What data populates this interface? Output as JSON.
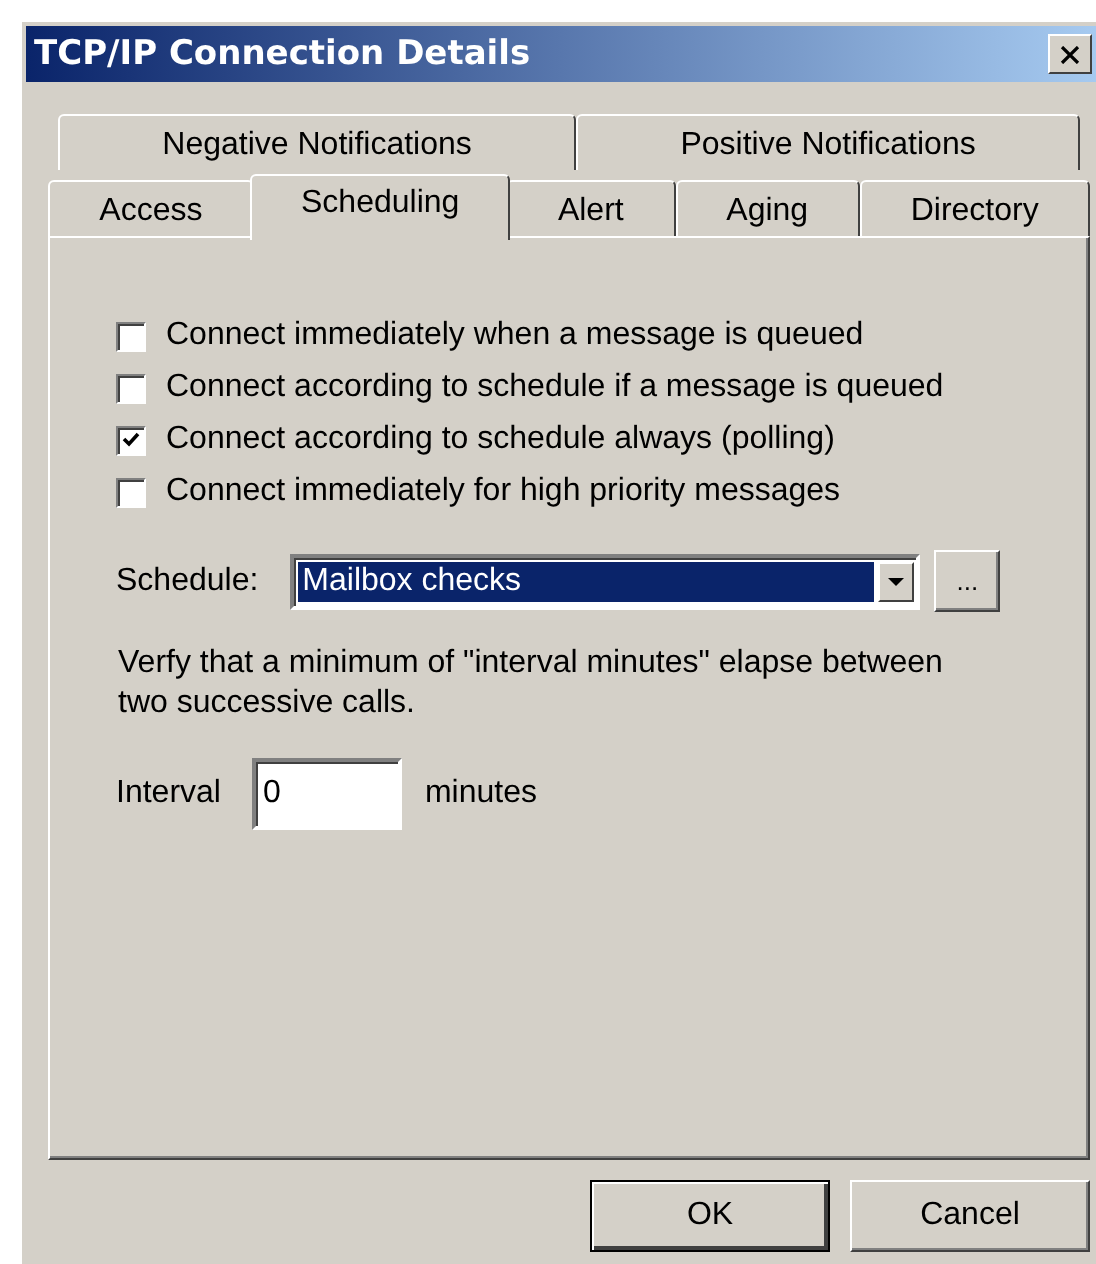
{
  "window": {
    "title": "TCP/IP Connection Details"
  },
  "tab_rows": [
    [
      {
        "label": "Negative Notifications",
        "selected": false
      },
      {
        "label": "Positive Notifications",
        "selected": false
      }
    ],
    [
      {
        "label": "Access",
        "selected": false
      },
      {
        "label": "Scheduling",
        "selected": true
      },
      {
        "label": "Alert",
        "selected": false
      },
      {
        "label": "Aging",
        "selected": false
      },
      {
        "label": "Directory",
        "selected": false
      }
    ]
  ],
  "options": [
    {
      "label": "Connect immediately when a message is queued",
      "checked": false
    },
    {
      "label": "Connect according to schedule if a message is queued",
      "checked": false
    },
    {
      "label": "Connect according to schedule always (polling)",
      "checked": true
    },
    {
      "label": "Connect immediately for high priority messages",
      "checked": false
    }
  ],
  "schedule": {
    "label": "Schedule:",
    "value": "Mailbox checks",
    "browse": "..."
  },
  "note": "Verfy that a minimum of \"interval minutes\" elapse between two successive calls.",
  "interval": {
    "label": "Interval",
    "value": "0",
    "unit": "minutes"
  },
  "buttons": [
    "OK",
    "Cancel"
  ]
}
